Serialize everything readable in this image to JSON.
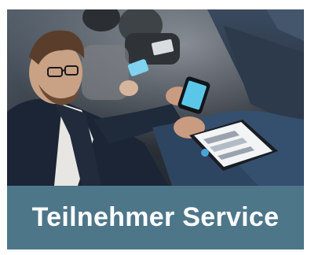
{
  "card": {
    "title": "Teilnehmer Service",
    "image_icon": "conference-attendee-smartphone-photo",
    "colors": {
      "banner": "#4e7689",
      "title_text": "#ffffff"
    }
  }
}
